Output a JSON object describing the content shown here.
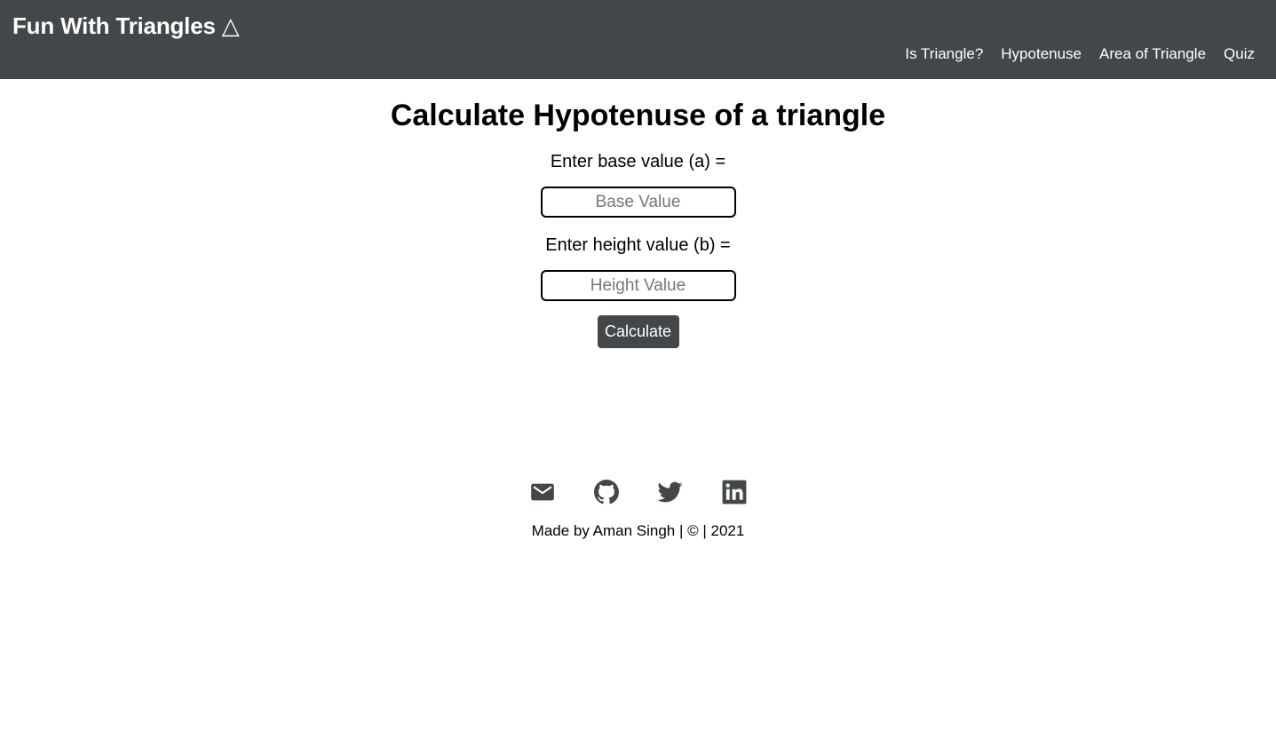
{
  "navbar": {
    "brand": "Fun With Triangles △",
    "links": [
      "Is Triangle?",
      "Hypotenuse",
      "Area of Triangle",
      "Quiz"
    ]
  },
  "main": {
    "title": "Calculate Hypotenuse of a triangle",
    "base_label": "Enter base value (a) =",
    "base_placeholder": "Base Value",
    "base_value": "",
    "height_label": "Enter height value (b) =",
    "height_placeholder": "Height Value",
    "height_value": "",
    "calculate_label": "Calculate"
  },
  "footer": {
    "icons": [
      "mail-icon",
      "github-icon",
      "twitter-icon",
      "linkedin-icon"
    ],
    "credit": "Made by Aman Singh | © | 2021"
  },
  "colors": {
    "nav_background": "#43474a",
    "button_background": "#43474a",
    "icon_color": "#43474a"
  }
}
